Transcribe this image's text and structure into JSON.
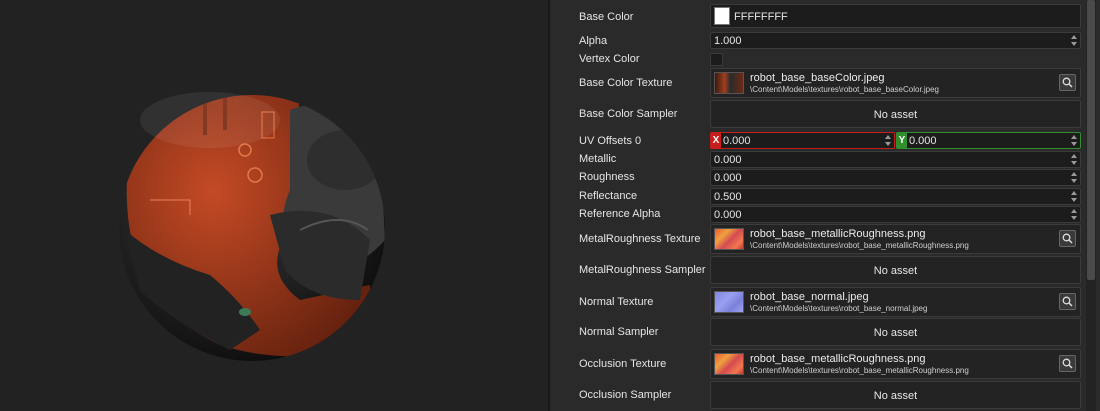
{
  "properties": {
    "base_color": {
      "label": "Base Color",
      "hex": "FFFFFFFF",
      "swatch_color": "#ffffff"
    },
    "alpha": {
      "label": "Alpha",
      "value": "1.000"
    },
    "vertex_color": {
      "label": "Vertex Color",
      "checked": false
    },
    "base_color_texture": {
      "label": "Base Color Texture",
      "name": "robot_base_baseColor.jpeg",
      "path": "\\Content\\Models\\textures\\robot_base_baseColor.jpeg"
    },
    "base_color_sampler": {
      "label": "Base Color Sampler",
      "value": "No asset"
    },
    "uv_offsets": {
      "label": "UV Offsets 0",
      "x_axis": "X",
      "x": "0.000",
      "y_axis": "Y",
      "y": "0.000",
      "x_color": "#c81d1d",
      "y_color": "#2f8f2f"
    },
    "metallic": {
      "label": "Metallic",
      "value": "0.000"
    },
    "roughness": {
      "label": "Roughness",
      "value": "0.000"
    },
    "reflectance": {
      "label": "Reflectance",
      "value": "0.500"
    },
    "reference_alpha": {
      "label": "Reference Alpha",
      "value": "0.000"
    },
    "metal_roughness_texture": {
      "label": "MetalRoughness Texture",
      "name": "robot_base_metallicRoughness.png",
      "path": "\\Content\\Models\\textures\\robot_base_metallicRoughness.png"
    },
    "metal_roughness_sampler": {
      "label": "MetalRoughness Sampler",
      "value": "No asset"
    },
    "normal_texture": {
      "label": "Normal Texture",
      "name": "robot_base_normal.jpeg",
      "path": "\\Content\\Models\\textures\\robot_base_normal.jpeg"
    },
    "normal_sampler": {
      "label": "Normal Sampler",
      "value": "No asset"
    },
    "occlusion_texture": {
      "label": "Occlusion Texture",
      "name": "robot_base_metallicRoughness.png",
      "path": "\\Content\\Models\\textures\\robot_base_metallicRoughness.png"
    },
    "occlusion_sampler": {
      "label": "Occlusion Sampler",
      "value": "No asset"
    }
  },
  "icons": {
    "picker": "search-icon",
    "spinner": "spinner-arrows-icon"
  },
  "colors": {
    "accent_orange": "#c9461f",
    "normal_map_blue": "#8a8ee6",
    "panel_bg": "#2a2a2a",
    "viewport_bg": "#222222"
  }
}
